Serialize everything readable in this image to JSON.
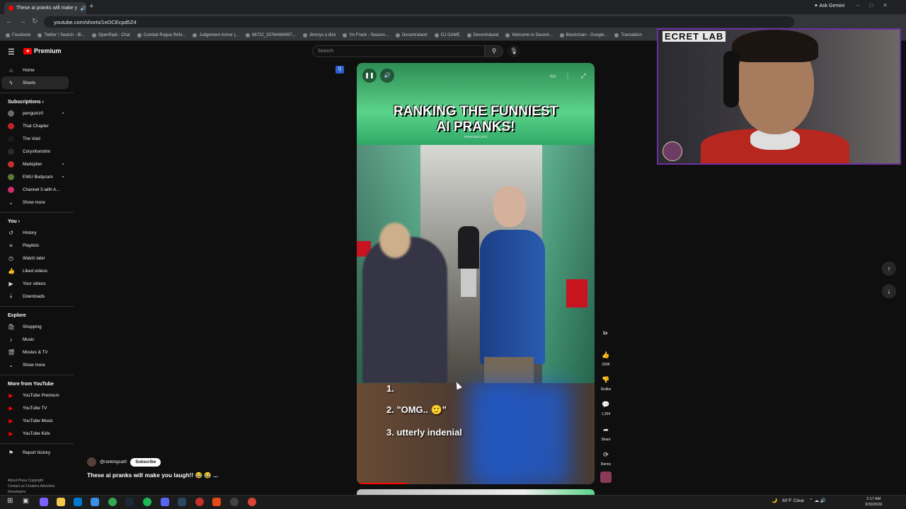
{
  "browser": {
    "tab_title": "These ai pranks will make y",
    "url": "youtube.com/shorts/1eDCEcpd5Z4",
    "ask_gemini": "Ask Gemini",
    "bookmarks": [
      "Facebook",
      "Twitter / Search - Bl...",
      "OpenRadi - Chat",
      "Combat Rogue Refo...",
      "Judgement Armor |...",
      "66722_33764484997...",
      "Jimmys a dick",
      "I'm Frank - Season...",
      "Decentraland",
      "OJ GAME",
      "Decentraland",
      "Welcome to Decent...",
      "Blockchain - Google...",
      "Translation"
    ]
  },
  "youtube": {
    "logo_text": "Premium",
    "search_placeholder": "Search"
  },
  "sidebar": {
    "main": [
      {
        "label": "Home",
        "icon": "home-icon"
      },
      {
        "label": "Shorts",
        "icon": "shorts-icon",
        "active": true
      }
    ],
    "subscriptions_heading": "Subscriptions",
    "subscriptions": [
      {
        "label": "penguinz0",
        "color": "#6b6b6b",
        "dot": true
      },
      {
        "label": "That Chapter",
        "color": "#c02424",
        "dot": false
      },
      {
        "label": "The Void",
        "color": "#1a1a1a",
        "dot": false
      },
      {
        "label": "CoryxKenshin",
        "color": "#2b2b2b",
        "dot": false
      },
      {
        "label": "Markiplier",
        "color": "#c92e2e",
        "dot": true
      },
      {
        "label": "EWU Bodycam",
        "color": "#5a7a3a",
        "dot": true
      },
      {
        "label": "Channel 5 with A...",
        "color": "#d02a6a",
        "dot": true
      }
    ],
    "show_more_1": "Show more",
    "you_heading": "You",
    "you_items": [
      {
        "label": "History",
        "icon": "history-icon"
      },
      {
        "label": "Playlists",
        "icon": "playlists-icon"
      },
      {
        "label": "Watch later",
        "icon": "watch-later-icon"
      },
      {
        "label": "Liked videos",
        "icon": "like-icon"
      },
      {
        "label": "Your videos",
        "icon": "your-videos-icon"
      },
      {
        "label": "Downloads",
        "icon": "download-icon"
      }
    ],
    "explore_heading": "Explore",
    "explore_items": [
      {
        "label": "Shopping",
        "icon": "shopping-icon"
      },
      {
        "label": "Music",
        "icon": "music-icon"
      },
      {
        "label": "Movies & TV",
        "icon": "movies-icon"
      }
    ],
    "show_more_2": "Show more",
    "more_heading": "More from YouTube",
    "more_items": [
      {
        "label": "YouTube Premium"
      },
      {
        "label": "YouTube TV"
      },
      {
        "label": "YouTube Music"
      },
      {
        "label": "YouTube Kids"
      }
    ],
    "report_history": "Report history",
    "footer_lines": [
      "About  Press  Copyright",
      "Contact us  Creators  Advertise",
      "Developers"
    ]
  },
  "short": {
    "headline_1": "RANKING THE FUNNIEST",
    "headline_2": "AI PRANKS!",
    "watermark": "RANKINGCATO",
    "rank_1": "1.",
    "rank_2": "2. \"OMG.. 🙂\"",
    "rank_3": "3. utterly indenial",
    "progress": 0.21,
    "channel": "@rankingcat0",
    "subscribe": "Subscribe",
    "title": "These ai pranks will make you laugh!! 😂 😂 ..."
  },
  "actions": {
    "speed": "1x",
    "like_count": "200K",
    "dislike": "Dislike",
    "comment_count": "1,264",
    "share": "Share",
    "remix": "Remix"
  },
  "taskbar": {
    "weather": "60°F  Clear",
    "time": "2:17 AM",
    "date": "3/30/2026"
  }
}
